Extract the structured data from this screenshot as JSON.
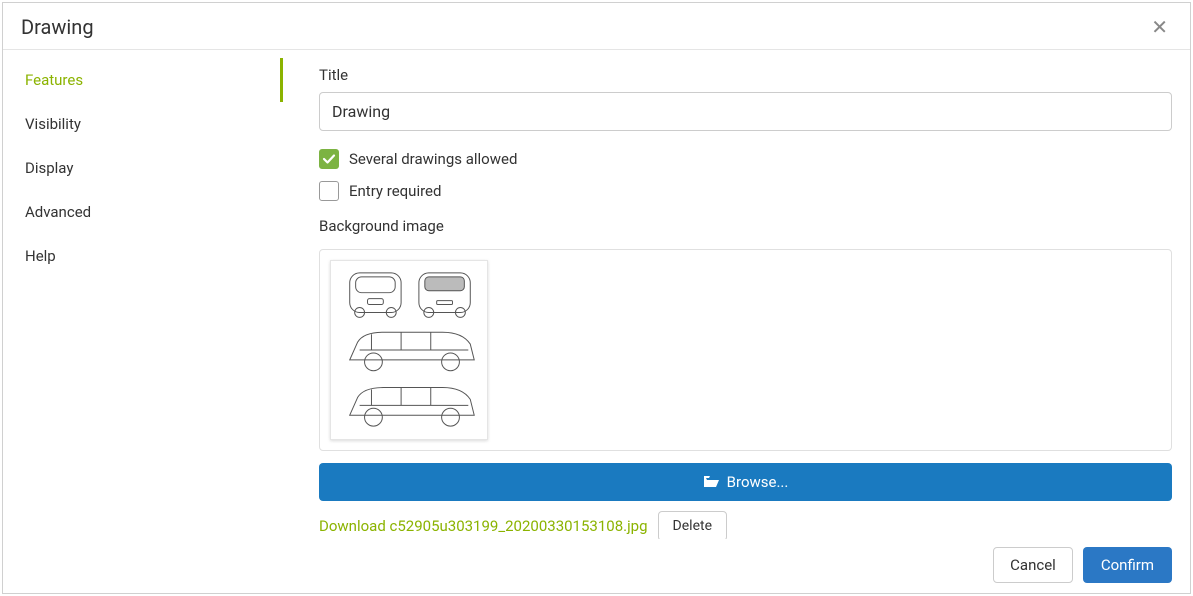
{
  "header": {
    "title": "Drawing"
  },
  "sidebar": {
    "items": [
      {
        "label": "Features",
        "active": true
      },
      {
        "label": "Visibility",
        "active": false
      },
      {
        "label": "Display",
        "active": false
      },
      {
        "label": "Advanced",
        "active": false
      },
      {
        "label": "Help",
        "active": false
      }
    ]
  },
  "form": {
    "title_label": "Title",
    "title_value": "Drawing",
    "several_label": "Several drawings allowed",
    "several_checked": true,
    "required_label": "Entry required",
    "required_checked": false,
    "bg_label": "Background image",
    "browse_label": "Browse...",
    "download_prefix": "Download ",
    "download_filename": "c52905u303199_20200330153108.jpg",
    "delete_label": "Delete"
  },
  "footer": {
    "cancel_label": "Cancel",
    "confirm_label": "Confirm"
  }
}
